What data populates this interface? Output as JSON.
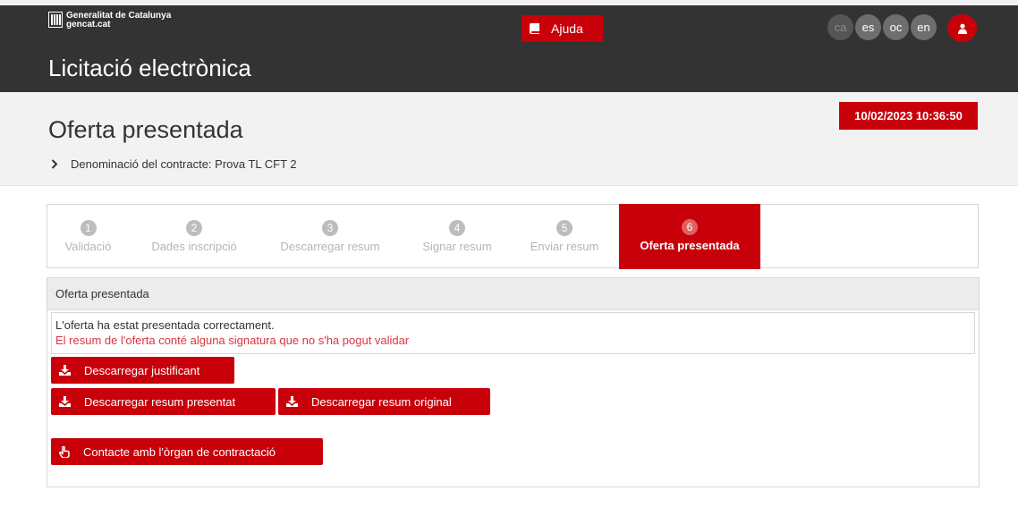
{
  "header": {
    "brand_line1": "Generalitat de Catalunya",
    "brand_line2": "gencat.cat",
    "help_label": "Ajuda",
    "app_title": "Licitació electrònica",
    "languages": [
      "ca",
      "es",
      "oc",
      "en"
    ],
    "current_language": "ca"
  },
  "page": {
    "title": "Oferta presentada",
    "datetime": "10/02/2023 10:36:50",
    "breadcrumb": "Denominació del contracte: Prova TL CFT 2"
  },
  "steps": [
    {
      "num": "1",
      "label": "Validació"
    },
    {
      "num": "2",
      "label": "Dades inscripció"
    },
    {
      "num": "3",
      "label": "Descarregar resum"
    },
    {
      "num": "4",
      "label": "Signar resum"
    },
    {
      "num": "5",
      "label": "Enviar resum"
    },
    {
      "num": "6",
      "label": "Oferta presentada"
    }
  ],
  "active_step": 6,
  "panel": {
    "title": "Oferta presentada",
    "message_ok": "L'oferta ha estat presentada correctament.",
    "message_warning": "El resum de l'oferta conté alguna signatura que no s'ha pogut validar",
    "buttons": {
      "download_receipt": "Descarregar justificant",
      "download_submitted": "Descarregar resum presentat",
      "download_original": "Descarregar resum original",
      "contact": "Contacte amb l'òrgan de contractació"
    }
  },
  "colors": {
    "brand_red": "#c8000a",
    "header_bg": "#333333",
    "band_bg": "#f2f2f2",
    "warning_text": "#d9363e"
  }
}
